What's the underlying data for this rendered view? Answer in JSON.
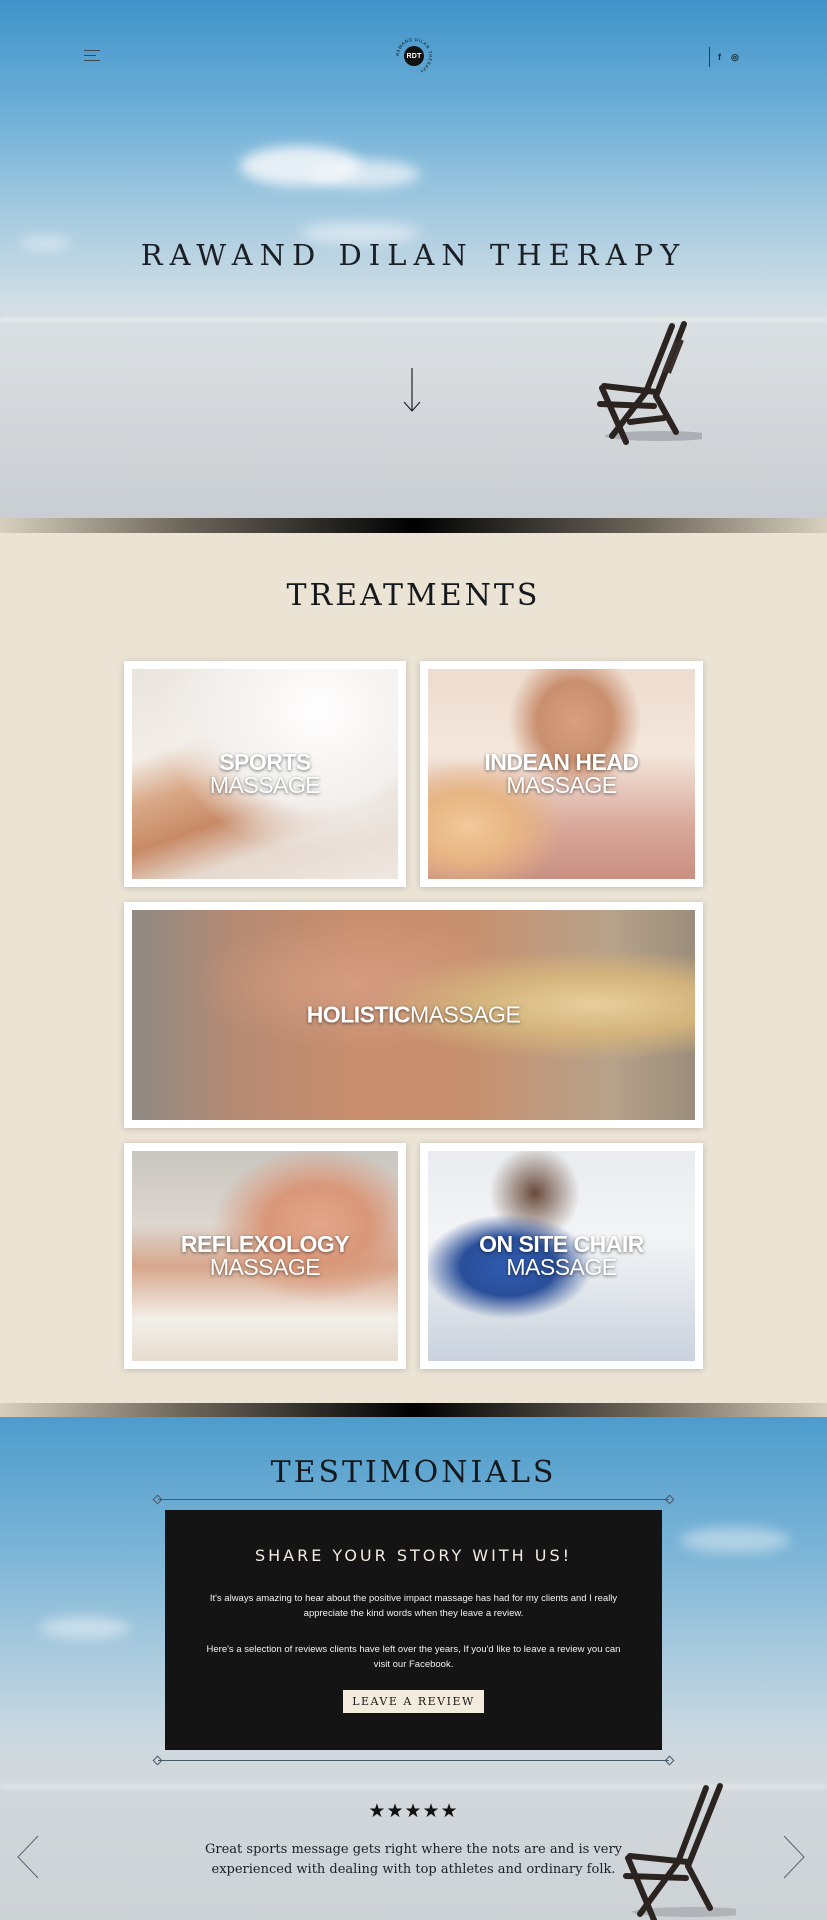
{
  "header": {
    "logo_text": "RDT",
    "logo_ring_text": "RAWAND DILAN THERAPY",
    "social": {
      "facebook": "f",
      "instagram": "◎"
    }
  },
  "hero": {
    "title": "RAWAND DILAN THERAPY"
  },
  "treatments": {
    "title": "TREATMENTS",
    "cards": [
      {
        "line1": "SPORTS",
        "line2": "MASSAGE"
      },
      {
        "line1": "INDEAN HEAD",
        "line2": "MASSAGE"
      },
      {
        "line1": "HOLISTIC",
        "line2": "MASSAGE"
      },
      {
        "line1": "REFLEXOLOGY",
        "line2": "MASSAGE"
      },
      {
        "line1": "ON SITE CHAIR",
        "line2": "MASSAGE"
      }
    ]
  },
  "testimonials": {
    "title": "TESTIMONIALS",
    "box_title": "SHARE YOUR STORY WITH US!",
    "paragraph1": "It's always amazing to hear about the positive impact massage has had for my clients and I really appreciate the kind words when they leave a review.",
    "paragraph2": "Here's a selection of reviews clients have left over the years, If you'd like to leave a review you can visit our Facebook.",
    "button": "LEAVE A REVIEW",
    "stars": "★★★★★",
    "quote": "Great sports message gets right where the nots are and is very experienced with dealing with top athletes and ordinary folk."
  }
}
